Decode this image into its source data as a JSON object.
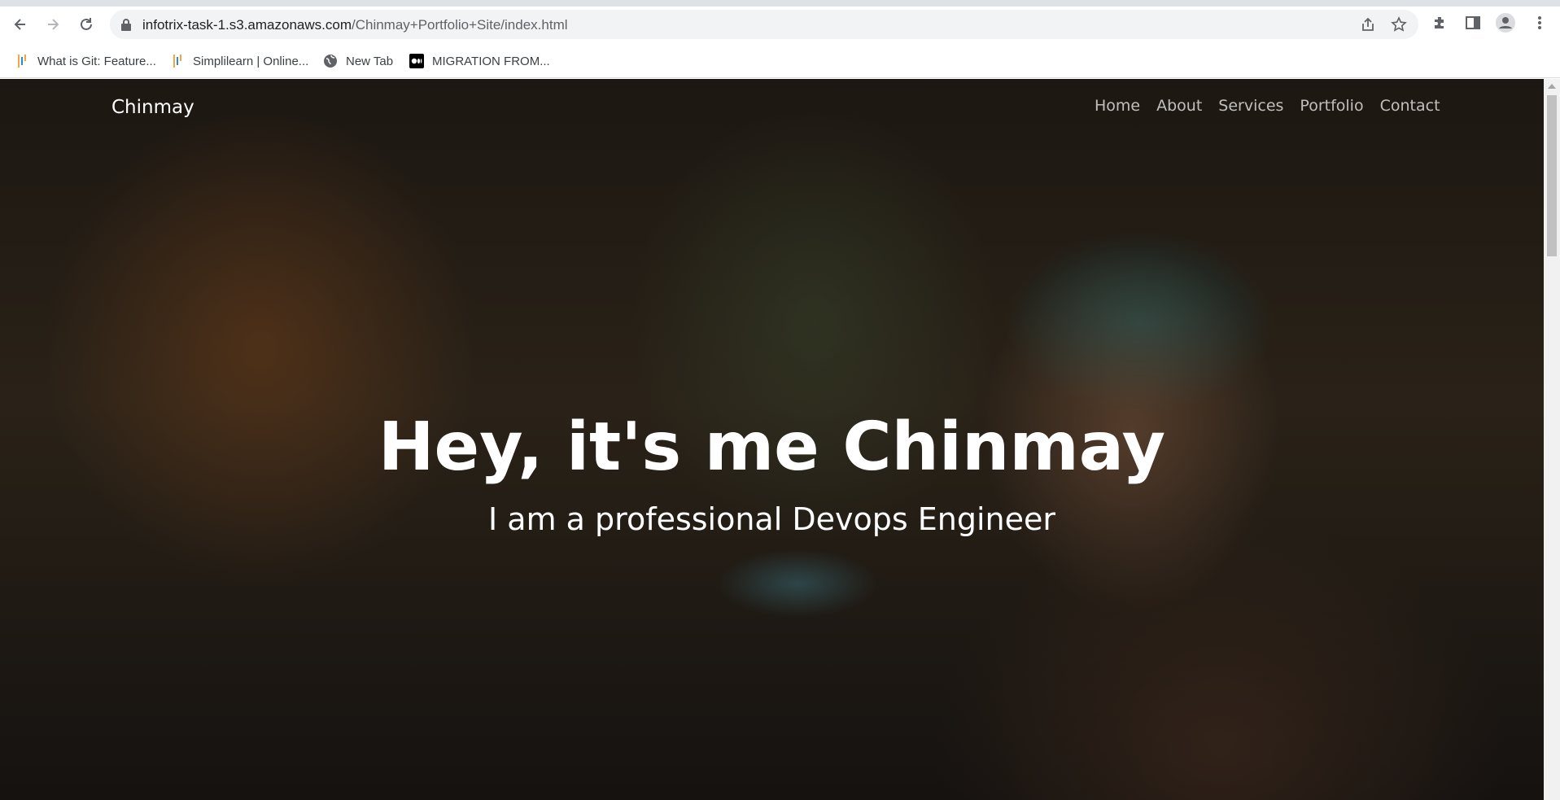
{
  "browser": {
    "url_host": "infotrix-task-1.s3.amazonaws.com",
    "url_path": "/Chinmay+Portfolio+Site/index.html",
    "bookmarks": [
      {
        "label": "What is Git: Feature...",
        "icon": "simplilearn-icon"
      },
      {
        "label": "Simplilearn | Online...",
        "icon": "simplilearn-icon"
      },
      {
        "label": "New Tab",
        "icon": "globe-icon"
      },
      {
        "label": "MIGRATION FROM...",
        "icon": "medium-icon"
      }
    ]
  },
  "site": {
    "brand": "Chinmay",
    "nav": [
      "Home",
      "About",
      "Services",
      "Portfolio",
      "Contact"
    ],
    "hero_title": "Hey, it's me Chinmay",
    "hero_subtitle": "I am a professional Devops Engineer"
  }
}
